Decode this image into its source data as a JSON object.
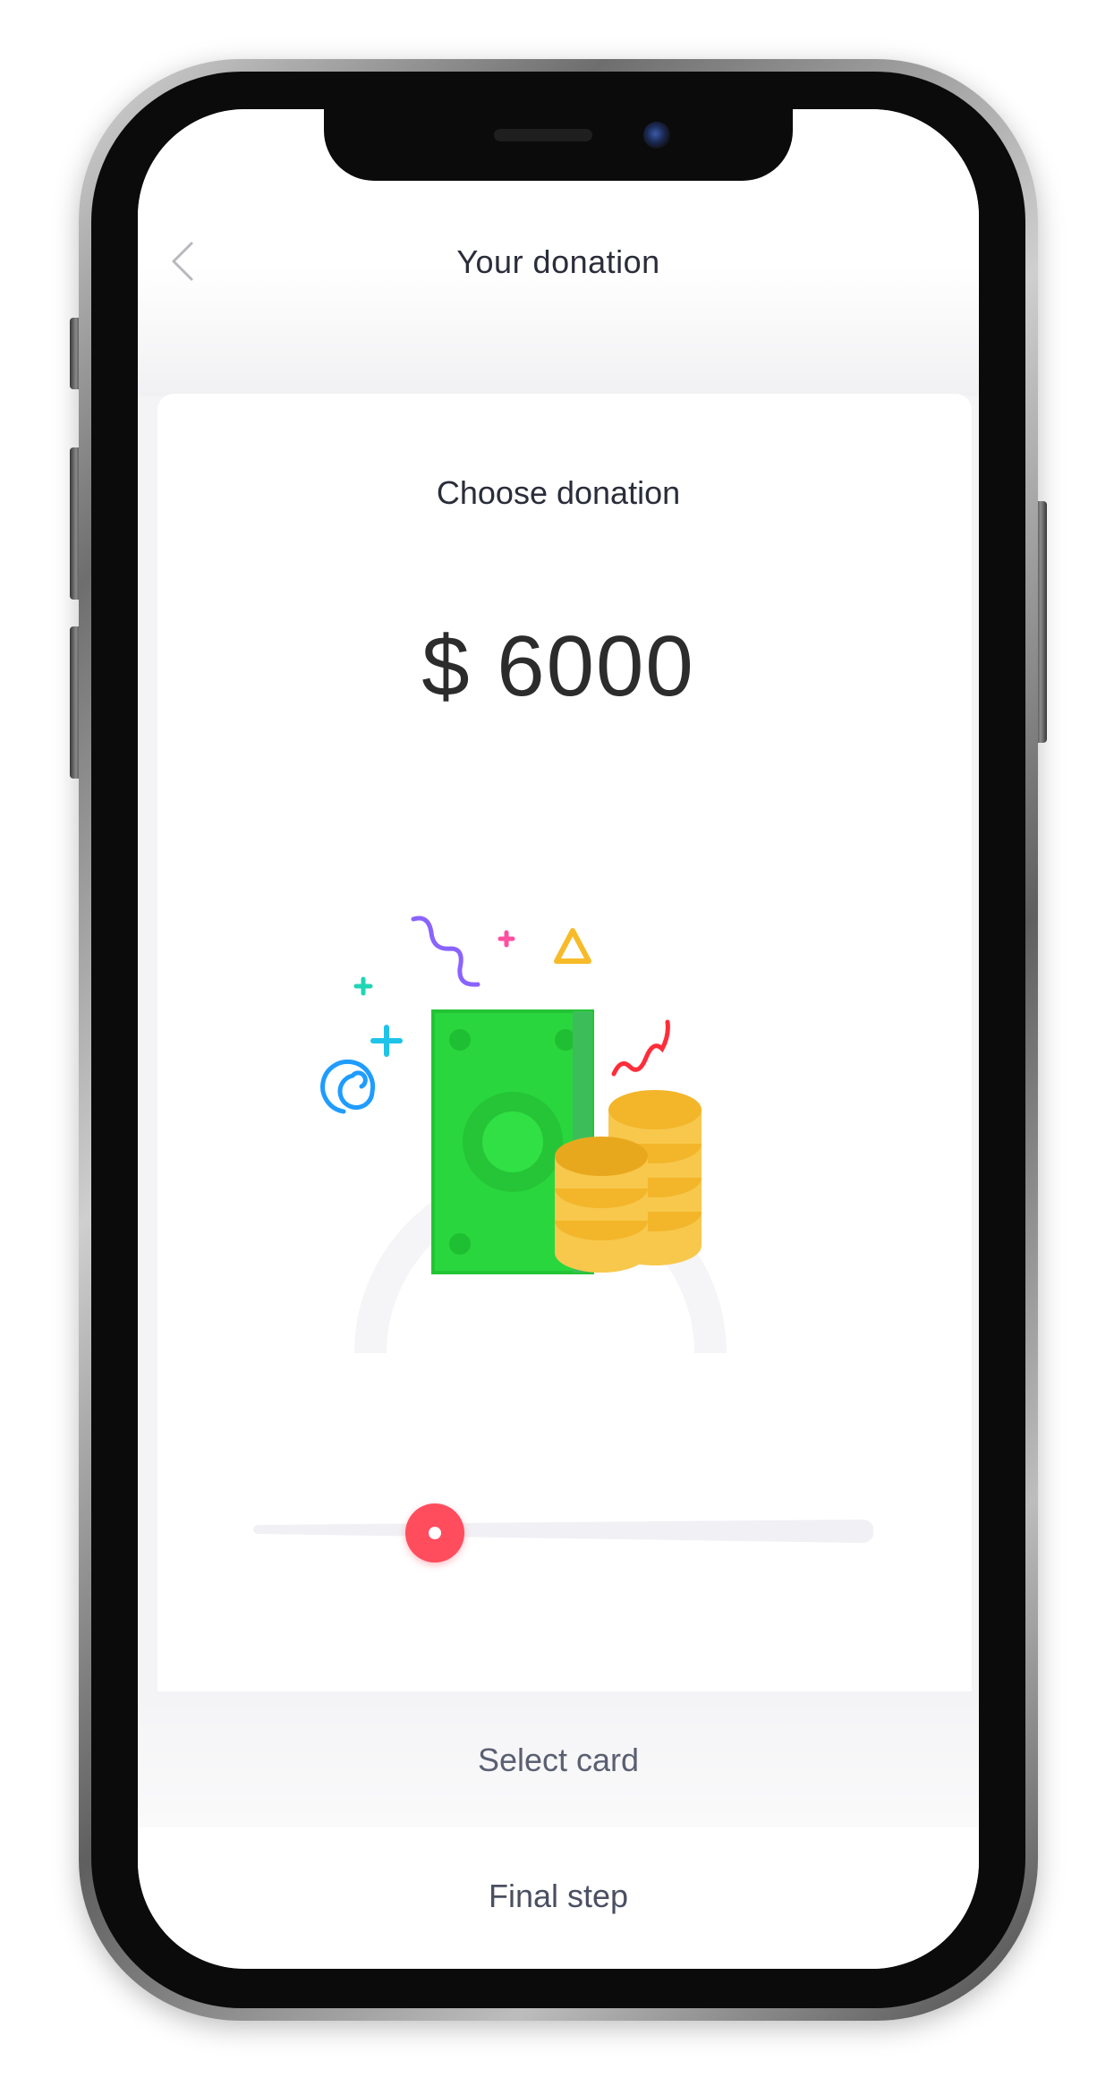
{
  "header": {
    "title": "Your donation",
    "back_icon": "chevron-left-icon"
  },
  "donation": {
    "heading": "Choose donation",
    "amount": "$ 6000",
    "slider_level": 0.3
  },
  "steps": {
    "select_card": "Select card",
    "final_step": "Final step"
  },
  "illustration": {
    "icon": "money-coins-illustration"
  },
  "colors": {
    "accent": "#ff4d5e",
    "bill_green": "#22d33a",
    "coin_gold": "#f7bb2a",
    "track": "#f0f0f5"
  }
}
